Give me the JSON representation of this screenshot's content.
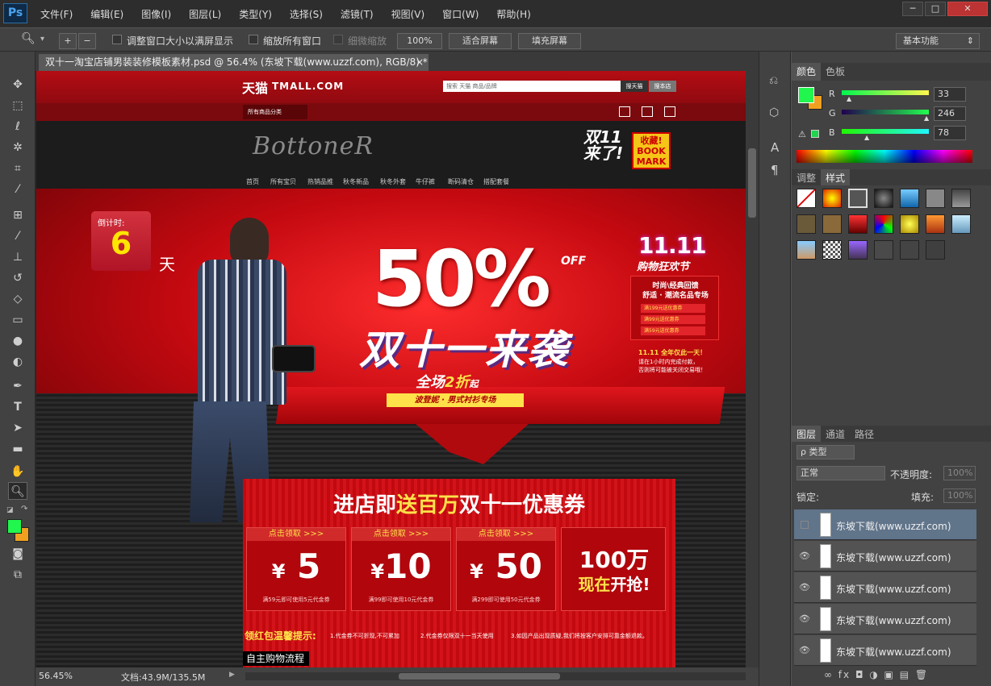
{
  "app": {
    "logo": "Ps",
    "menu": [
      "文件(F)",
      "编辑(E)",
      "图像(I)",
      "图层(L)",
      "类型(Y)",
      "选择(S)",
      "滤镜(T)",
      "视图(V)",
      "窗口(W)",
      "帮助(H)"
    ],
    "win_min": "─",
    "win_max": "□",
    "win_close": "✕"
  },
  "options": {
    "resize_windows": "调整窗口大小以满屏显示",
    "zoom_all": "缩放所有窗口",
    "scrubby_zoom": "细微缩放",
    "zoom_pct": "100%",
    "fit_screen": "适合屏幕",
    "fill_screen": "填充屏幕",
    "workspace": "基本功能"
  },
  "document": {
    "tab": "双十一淘宝店铺男装装修模板素材.psd @ 56.4% (东坡下载(www.uzzf.com), RGB/8) *",
    "tab_close": "×"
  },
  "status": {
    "zoom": "56.45%",
    "doc_size": "文档:43.9M/135.5M"
  },
  "design": {
    "tmall_logo": "天猫",
    "tmall_en": "TMALL.COM",
    "search_placeholder": "搜索 天猫 商品/品牌",
    "search_btn1": "搜天猫",
    "search_btn2": "搜本店",
    "all_cats": "所有商品分类",
    "brand": "BottoneR",
    "nav": [
      "首页",
      "所有宝贝",
      "热销品推",
      "秋冬新品",
      "秋冬外套",
      "牛仔裤",
      "断码清仓",
      "搭配套餐"
    ],
    "d11_title": "双11来了!",
    "bookmark1": "收藏!",
    "bookmark2": "BOOK",
    "bookmark3": "MARK",
    "countdown_label": "倒计时:",
    "countdown_num": "6",
    "countdown_unit": "天",
    "sale_pct": "50%",
    "sale_off": "OFF",
    "sale_title": "双十一来袭",
    "sale_sub1": "全场",
    "sale_sub2": "2折",
    "sale_sub3": "起",
    "sale_tag": "波登妮 · 男式衬衫专场",
    "shop_1111": "11.11",
    "shop_festival": "购物狂欢节",
    "shop_line1": "时尚\\经典回馈",
    "shop_line2": "舒适 · 潮流名品专场",
    "shop_coupons": [
      "满199元送优惠券",
      "满99元送优惠券",
      "满59元送优惠券"
    ],
    "shop_note1": "11.11 全年仅此一天！",
    "shop_note2": "请在1小时内完成付款，",
    "shop_note3": "否则将可能被关闭交易哦！",
    "coupon_title_a": "进店即",
    "coupon_title_b": "送百万",
    "coupon_title_c": "双十一优惠券",
    "coupon_claim": "点击领取 >>>",
    "coupons": [
      {
        "val": "5",
        "desc": "满59元即可使用5元代金券"
      },
      {
        "val": "10",
        "desc": "满99即可使用10元代金券"
      },
      {
        "val": "50",
        "desc": "满299即可使用50元代金券"
      }
    ],
    "yen": "¥",
    "million1": "100万",
    "million2a": "现在",
    "million2b": "开抢!",
    "tips_label": "领红包温馨提示:",
    "tips": [
      "1.代金券不可折现,不可累加",
      "2.代金券仅限双十一当天使用",
      "3.如因产品出现质疑,我们将按客户安排可靠金额退款。"
    ],
    "flow": "自主购物流程"
  },
  "color_panel": {
    "tabs": [
      "颜色",
      "色板"
    ],
    "r_label": "R",
    "g_label": "G",
    "b_label": "B",
    "r": "33",
    "g": "246",
    "b": "78",
    "fg": "#21f64e",
    "bg": "#f0a020",
    "warn": "⚠"
  },
  "styles_panel": {
    "tabs": [
      "调整",
      "样式"
    ]
  },
  "layers_panel": {
    "tabs": [
      "图层",
      "通道",
      "路径"
    ],
    "kind": "ρ 类型",
    "blend": "正常",
    "opacity_label": "不透明度:",
    "opacity": "100%",
    "lock_label": "锁定:",
    "fill_label": "填充:",
    "fill": "100%",
    "layers": [
      "东坡下载(www.uzzf.com)",
      "东坡下载(www.uzzf.com)",
      "东坡下载(www.uzzf.com)",
      "东坡下载(www.uzzf.com)",
      "东坡下载(www.uzzf.com)"
    ],
    "bottom_icons": "∞  fx  ◘  ◑  ▣  ▤  🗑"
  },
  "tool_icons": [
    "move-icon",
    "marquee-icon",
    "lasso-icon",
    "magic-wand-icon",
    "crop-icon",
    "eyedropper-icon",
    "spot-healing-icon",
    "brush-icon",
    "clone-stamp-icon",
    "history-brush-icon",
    "eraser-icon",
    "gradient-icon",
    "blur-icon",
    "dodge-icon",
    "pen-icon",
    "type-icon",
    "path-selection-icon",
    "rectangle-icon",
    "hand-icon",
    "zoom-icon"
  ]
}
